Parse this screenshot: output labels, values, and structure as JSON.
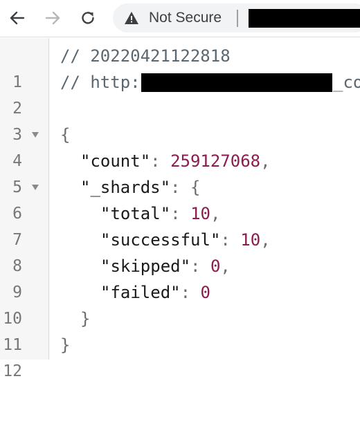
{
  "toolbar": {
    "back_icon": "arrow-left-icon",
    "forward_icon": "arrow-right-icon",
    "reload_icon": "reload-icon",
    "security_icon": "warning-triangle-icon",
    "security_label": "Not Secure"
  },
  "editor": {
    "lines": [
      {
        "number": "1",
        "comment": "// 20220421122818"
      },
      {
        "number": "2",
        "comment": "// http:",
        "comment_tail": "_co"
      },
      {
        "number": "3"
      },
      {
        "number": "4",
        "text": "{"
      },
      {
        "number": "5",
        "key": "\"count\"",
        "sep": ": ",
        "value": "259127068",
        "end": ","
      },
      {
        "number": "6",
        "key": "\"_shards\"",
        "sep": ": ",
        "open": "{"
      },
      {
        "number": "7",
        "key": "\"total\"",
        "sep": ": ",
        "value": "10",
        "end": ","
      },
      {
        "number": "8",
        "key": "\"successful\"",
        "sep": ": ",
        "value": "10",
        "end": ","
      },
      {
        "number": "9",
        "key": "\"skipped\"",
        "sep": ": ",
        "value": "0",
        "end": ","
      },
      {
        "number": "10",
        "key": "\"failed\"",
        "sep": ": ",
        "value": "0"
      },
      {
        "number": "11",
        "text": "}"
      },
      {
        "number": "12",
        "text": "}"
      }
    ]
  },
  "colors": {
    "number": "#8a1c4f",
    "comment": "#5b6770",
    "gutter": "#f6f6f6",
    "omnibox": "#f1f3f4"
  }
}
